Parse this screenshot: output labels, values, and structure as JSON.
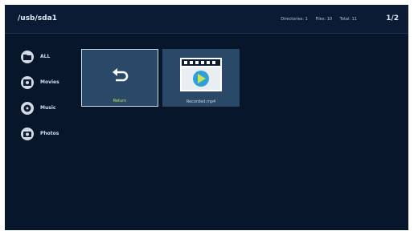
{
  "header": {
    "path": "/usb/sda1",
    "directories": "Directories: 1",
    "files": "Files: 10",
    "total": "Total: 11",
    "page": "1/2"
  },
  "sidebar": {
    "items": [
      {
        "label": "ALL",
        "icon": "folder-icon"
      },
      {
        "label": "Movies",
        "icon": "movie-icon"
      },
      {
        "label": "Music",
        "icon": "music-icon"
      },
      {
        "label": "Photos",
        "icon": "photo-icon"
      }
    ]
  },
  "grid": {
    "items": [
      {
        "label": "Return",
        "icon": "return-icon"
      },
      {
        "label": "Recorded.mp4",
        "icon": "video-file-icon"
      }
    ]
  },
  "colors": {
    "background": "#08162c",
    "tile": "#2a4868",
    "selected_label": "#c9e34d",
    "play_button": "#2e9fd8"
  }
}
